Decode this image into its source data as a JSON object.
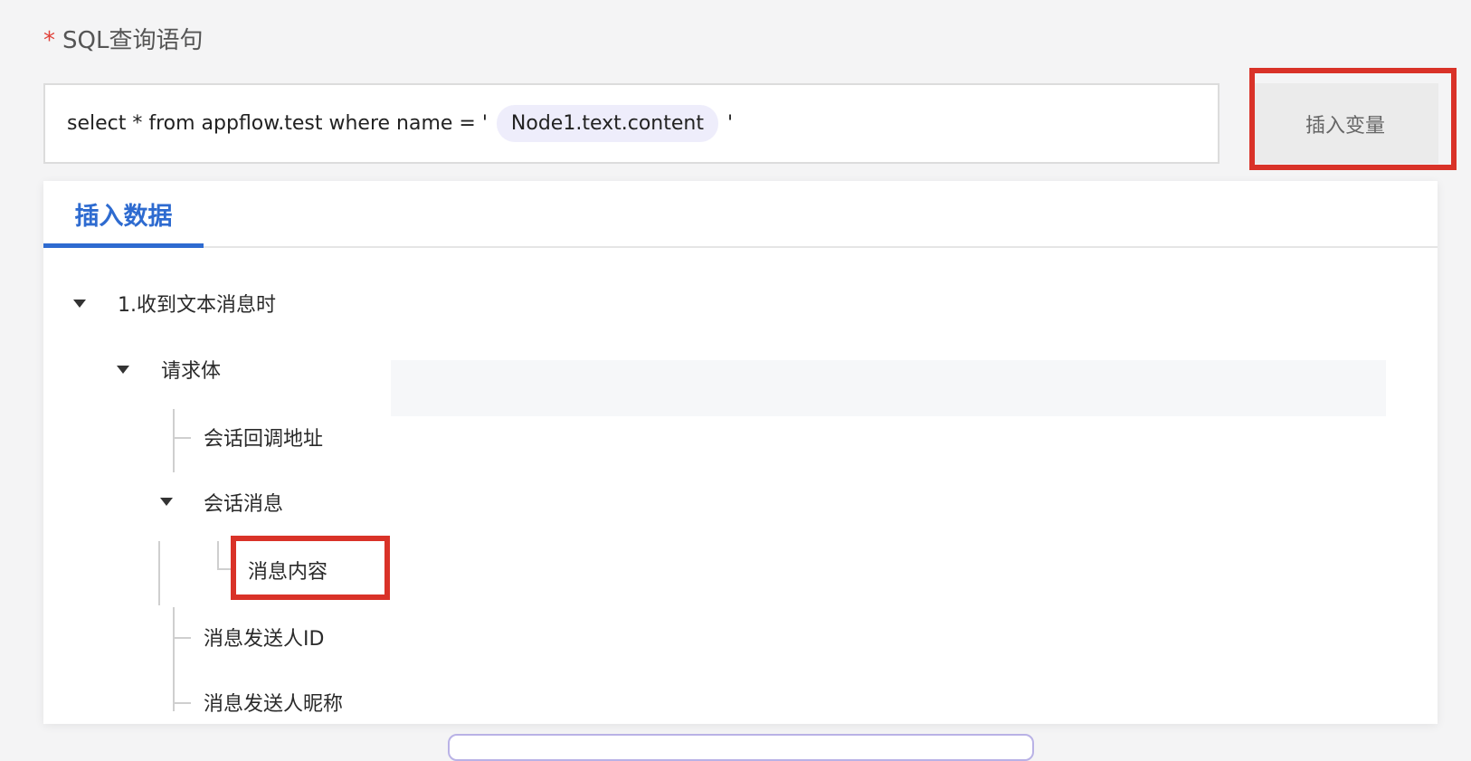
{
  "field": {
    "required_mark": "*",
    "label": "SQL查询语句",
    "query_prefix": "select * from appflow.test where name = '",
    "variable_chip": "Node1.text.content",
    "query_suffix": "'"
  },
  "insert_variable_button": "插入变量",
  "panel": {
    "tab_label": "插入数据",
    "tree": {
      "root": "1.收到文本消息时",
      "request_body": "请求体",
      "callback_address": "会话回调地址",
      "conversation_message": "会话消息",
      "message_content": "消息内容",
      "sender_id": "消息发送人ID",
      "sender_nickname": "消息发送人昵称"
    }
  },
  "colors": {
    "accent": "#2e6bd0",
    "highlight": "#d93228",
    "chip_bg": "#eeedfb",
    "required": "#e0423a"
  }
}
